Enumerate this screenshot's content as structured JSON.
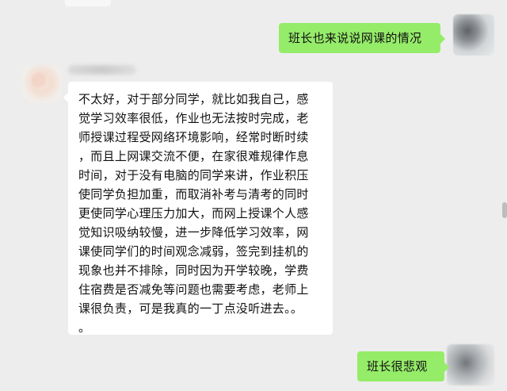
{
  "chat": {
    "messages": [
      {
        "side": "right",
        "text": "班长也来说说网课的情况"
      },
      {
        "side": "left",
        "text": "不太好，对于部分同学，就比如我自己，感\n觉学习效率很低，作业也无法按时完成，老\n师授课过程受网络环境影响，经常时断时续\n，而且上网课交流不便，在家很难规律作息\n时间，对于没有电脑的同学来讲，作业积压\n使同学负担加重，而取消补考与清考的同时\n更使同学心理压力加大，而网上授课个人感\n觉知识吸纳较慢，进一步降低学习效率，网\n课使同学们的时间观念减弱，签完到挂机的\n现象也并不排除，同时因为开学较晚，学费\n住宿费是否减免等问题也需要考虑，老师上\n课很负责，可是我真的一丁点没听进去。。\n。"
      },
      {
        "side": "right",
        "text": "班长很悲观"
      }
    ]
  },
  "colors": {
    "background": "#ededed",
    "green_bubble": "#95ec69",
    "white_bubble": "#ffffff"
  }
}
